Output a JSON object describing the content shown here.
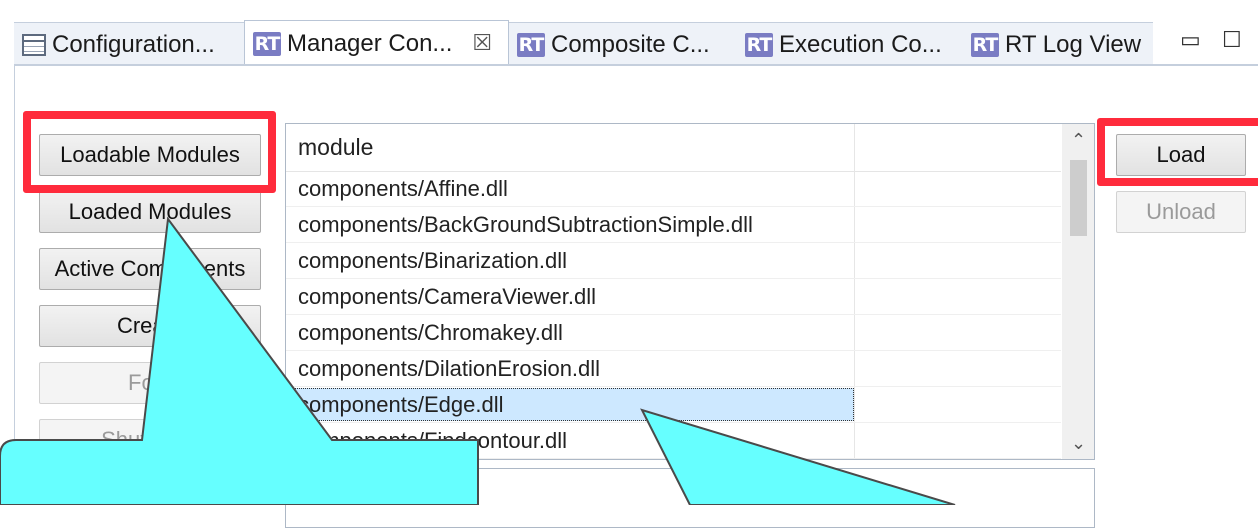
{
  "tabs": [
    {
      "label": "Configuration...",
      "icon": "table-icon",
      "active": false
    },
    {
      "label": "Manager Con...",
      "icon": "rt-icon",
      "active": true,
      "close": "☒"
    },
    {
      "label": "Composite C...",
      "icon": "rt-icon",
      "active": false
    },
    {
      "label": "Execution Co...",
      "icon": "rt-icon",
      "active": false
    },
    {
      "label": "RT Log View",
      "icon": "rt-icon",
      "active": false
    }
  ],
  "rt_icon_text": "RT",
  "window_controls": {
    "minimize": "▭",
    "maximize": "☐"
  },
  "left_buttons": {
    "loadable_modules": "Loadable Modules",
    "loaded_modules": "Loaded Modules",
    "active_components": "Active Components",
    "create": "Create",
    "fork": "Fork",
    "shutdown": "Shutdown"
  },
  "right_buttons": {
    "load": "Load",
    "unload": "Unload"
  },
  "module_table": {
    "header": "module",
    "rows": [
      "components/Affine.dll",
      "components/BackGroundSubtractionSimple.dll",
      "components/Binarization.dll",
      "components/CameraViewer.dll",
      "components/Chromakey.dll",
      "components/DilationErosion.dll",
      "components/Edge.dll",
      "components/Findcontour.dll"
    ],
    "selected_row": "components/Edge.dll",
    "scroll_up": "⌃",
    "scroll_down": "⌄"
  },
  "colors": {
    "highlight_border": "#ff2b3c",
    "callout_fill": "#66ffff",
    "selection": "#cde8ff",
    "rt_icon": "#7a7cc3"
  }
}
